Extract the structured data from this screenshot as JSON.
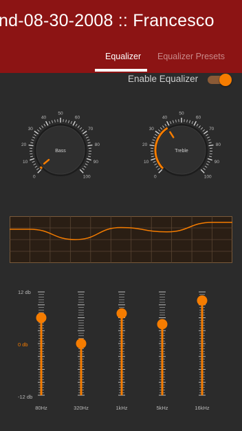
{
  "titlebar": {
    "title": "nd-08-30-2008 :: Francesco"
  },
  "tabs": [
    {
      "label": "Equalizer",
      "active": true
    },
    {
      "label": "Equalizer Presets",
      "active": false
    }
  ],
  "enable": {
    "label": "Enable Equalizer",
    "on": true
  },
  "knobs": {
    "bass": {
      "label": "Bass",
      "value": 2,
      "ticks": [
        "0",
        "10",
        "20",
        "30",
        "40",
        "50",
        "60",
        "70",
        "80",
        "90",
        "100"
      ]
    },
    "treble": {
      "label": "Treble",
      "value": 38,
      "ticks": [
        "0",
        "10",
        "20",
        "30",
        "40",
        "50",
        "60",
        "70",
        "80",
        "90",
        "100"
      ]
    }
  },
  "equalizer": {
    "db_top": "12 db",
    "db_mid": "0 db",
    "db_bottom": "-12 db",
    "bands": [
      {
        "label": "80Hz",
        "db": 6
      },
      {
        "label": "320Hz",
        "db": 0
      },
      {
        "label": "1kHz",
        "db": 7
      },
      {
        "label": "5kHz",
        "db": 4.5
      },
      {
        "label": "16kHz",
        "db": 10
      }
    ]
  },
  "colors": {
    "accent": "#f57c00",
    "titlebar": "#8c1414",
    "background": "#2b2b2b"
  }
}
